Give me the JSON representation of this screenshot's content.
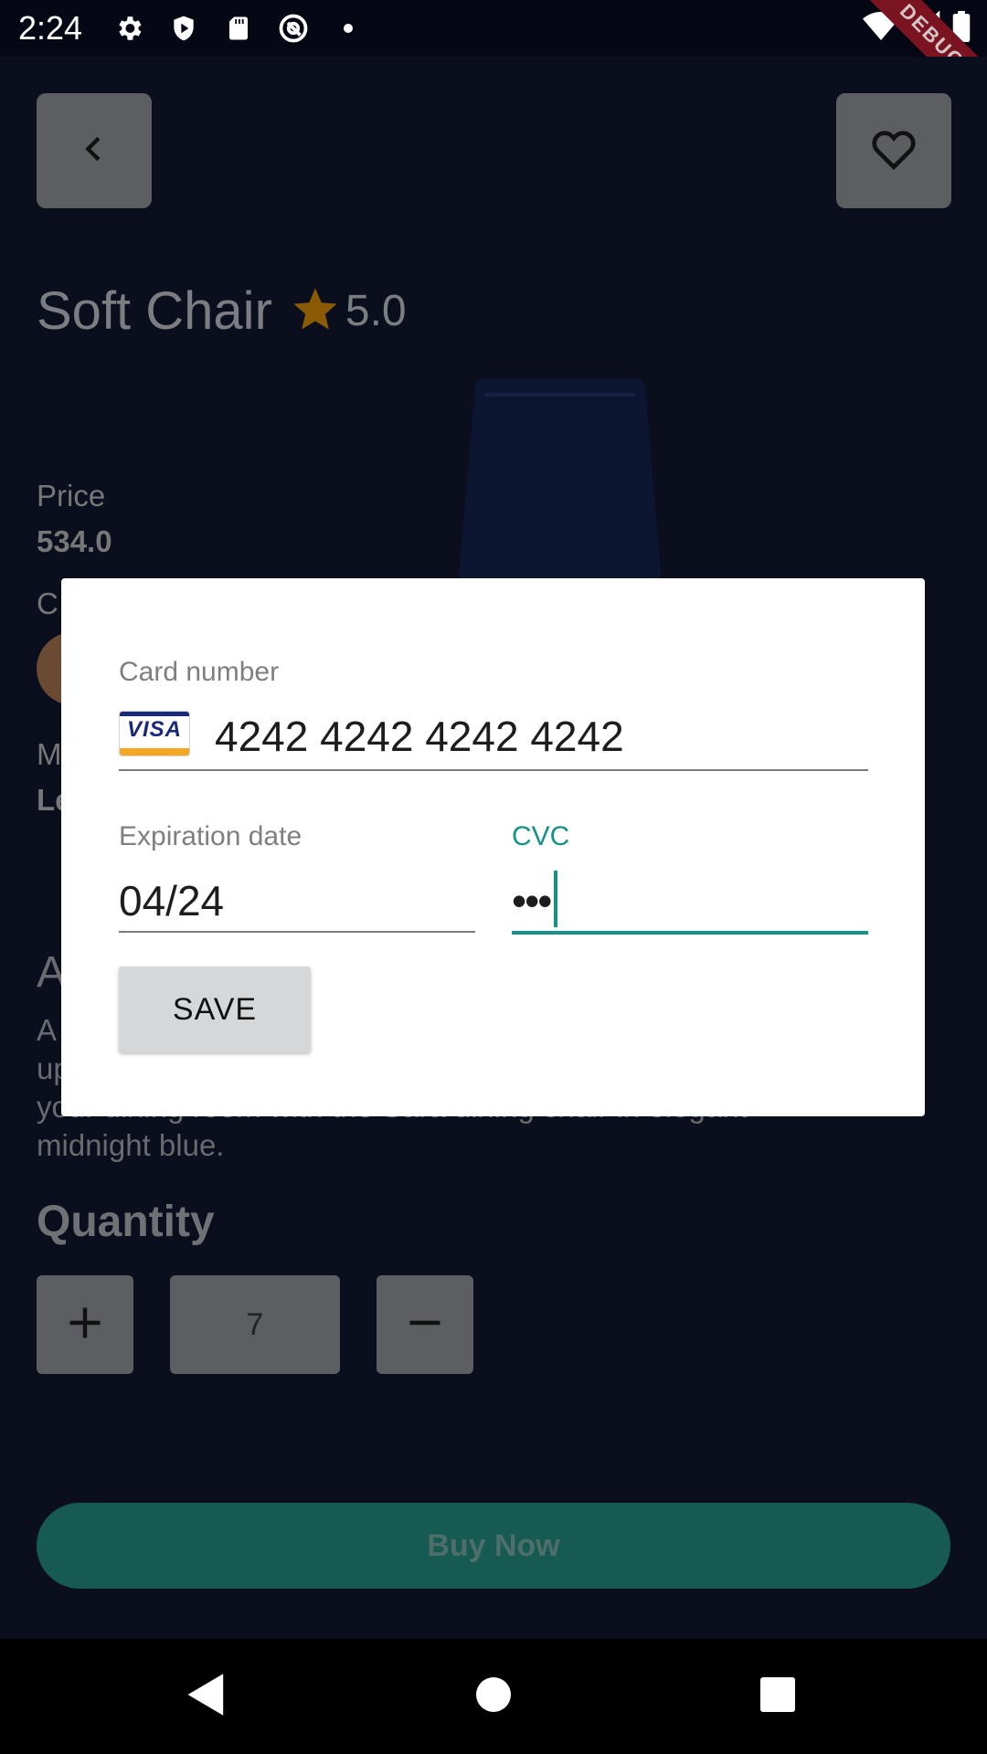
{
  "status_bar": {
    "time": "2:24",
    "debug_label": "DEBUG"
  },
  "product": {
    "title": "Soft Chair",
    "rating": "5.0",
    "price_label": "Price",
    "price_value": "534.0",
    "color_label_partial": "C",
    "material_label_partial": "M",
    "material_value_partial": "Le",
    "description_heading_partial": "A",
    "description_lines": [
      "A",
      "up",
      "your dining room with the Sara dining chair in elegant",
      "midnight blue."
    ],
    "quantity_heading": "Quantity",
    "quantity_value": "7",
    "buy_label": "Buy Now"
  },
  "dialog": {
    "card_number_label": "Card number",
    "card_number_value": "4242 4242 4242 4242",
    "card_brand": "VISA",
    "expiration_label": "Expiration date",
    "expiration_value": "04/24",
    "cvc_label": "CVC",
    "cvc_value": "•••",
    "save_label": "SAVE"
  },
  "colors": {
    "accent": "#16928a",
    "background": "#0a0e1d",
    "buy_button": "#175a52",
    "star": "#8a5a05"
  }
}
